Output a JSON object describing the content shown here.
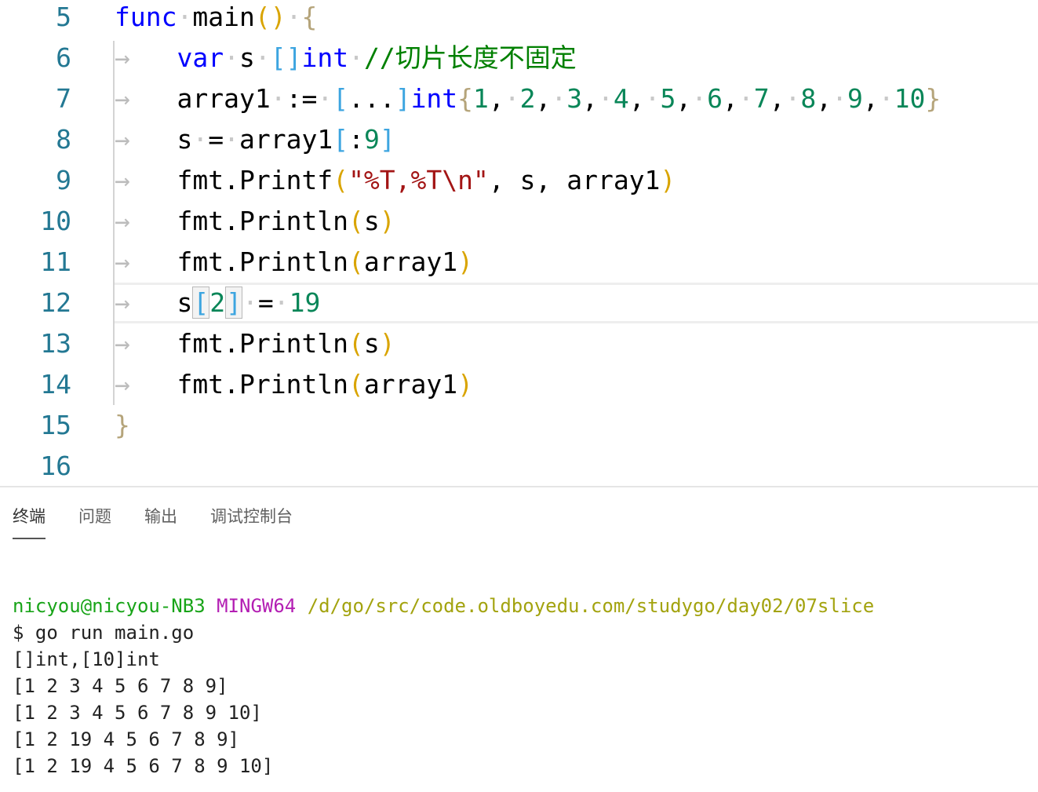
{
  "editor": {
    "line_numbers": [
      "5",
      "6",
      "7",
      "8",
      "9",
      "10",
      "11",
      "12",
      "13",
      "14",
      "15",
      "16"
    ],
    "current_line": "12",
    "lines": {
      "l5": {
        "func": "func",
        "name": "main",
        "open_paren": "(",
        "close_paren": ")",
        "brace": "{"
      },
      "l6": {
        "var": "var",
        "ident": "s",
        "lbr": "[",
        "rbr": "]",
        "type": "int",
        "comment": "//切片长度不固定"
      },
      "l7": {
        "ident": "array1",
        "op": ":=",
        "lbr": "[",
        "dots": "...",
        "rbr": "]",
        "type": "int",
        "lbrace": "{",
        "values": [
          "1",
          "2",
          "3",
          "4",
          "5",
          "6",
          "7",
          "8",
          "9",
          "10"
        ],
        "rbrace": "}"
      },
      "l8": {
        "ident": "s",
        "op": "=",
        "src": "array1",
        "lbr": "[",
        "colon": ":",
        "num": "9",
        "rbr": "]"
      },
      "l9": {
        "pkg": "fmt",
        "dot": ".",
        "fn": "Printf",
        "lp": "(",
        "str": "\"%T,%T\\n\"",
        "args": ", s, array1",
        "rp": ")"
      },
      "l10": {
        "pkg": "fmt",
        "dot": ".",
        "fn": "Println",
        "lp": "(",
        "arg": "s",
        "rp": ")"
      },
      "l11": {
        "pkg": "fmt",
        "dot": ".",
        "fn": "Println",
        "lp": "(",
        "arg": "array1",
        "rp": ")"
      },
      "l12": {
        "ident": "s",
        "lbr": "[",
        "idx": "2",
        "rbr": "]",
        "op": "=",
        "num": "19"
      },
      "l13": {
        "pkg": "fmt",
        "dot": ".",
        "fn": "Println",
        "lp": "(",
        "arg": "s",
        "rp": ")"
      },
      "l14": {
        "pkg": "fmt",
        "dot": ".",
        "fn": "Println",
        "lp": "(",
        "arg": "array1",
        "rp": ")"
      },
      "l15": {
        "brace": "}"
      }
    }
  },
  "panel": {
    "tabs": [
      {
        "label": "终端",
        "active": true
      },
      {
        "label": "问题",
        "active": false
      },
      {
        "label": "输出",
        "active": false
      },
      {
        "label": "调试控制台",
        "active": false
      }
    ]
  },
  "terminal": {
    "user": "nicyou@nicyou-NB3",
    "system": "MINGW64",
    "path": "/d/go/src/code.oldboyedu.com/studygo/day02/07slice",
    "command": "$ go run main.go",
    "output": [
      "[]int,[10]int",
      "[1 2 3 4 5 6 7 8 9]",
      "[1 2 3 4 5 6 7 8 9 10]",
      "[1 2 19 4 5 6 7 8 9]",
      "[1 2 19 4 5 6 7 8 9 10]"
    ]
  },
  "colors": {
    "keyword": "#0000ff",
    "number": "#098658",
    "string": "#a31515",
    "comment": "#008000",
    "line_number": "#237893",
    "terminal_user": "#18a418",
    "terminal_system": "#b31eb3",
    "terminal_path": "#a3a30f"
  }
}
